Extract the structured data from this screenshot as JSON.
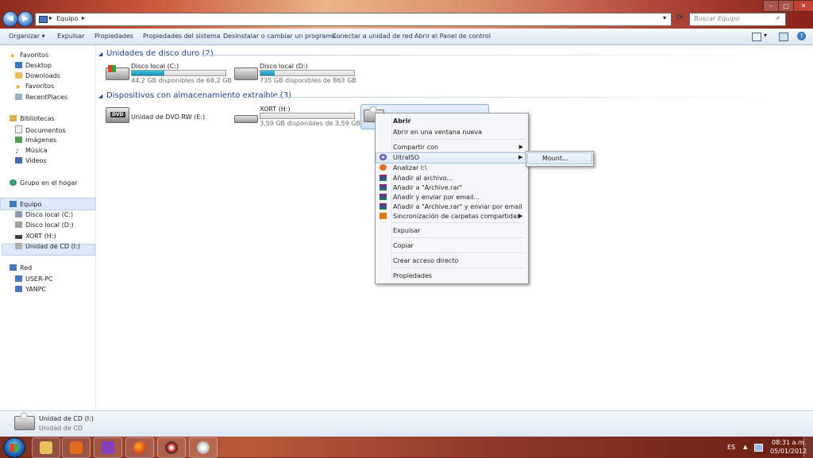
{
  "window": {
    "address_crumb": "Equipo",
    "search_placeholder": "Buscar Equipo"
  },
  "toolbar": {
    "items": [
      "Organizar",
      "Expulsar",
      "Propiedades",
      "Propiedades del sistema",
      "Desinstalar o cambiar un programa",
      "Conectar a unidad de red",
      "Abrir el Panel de control"
    ]
  },
  "nav": {
    "favoritos": "Favoritos",
    "fav_items": [
      "Desktop",
      "Downloads",
      "Favoritos",
      "RecentPlaces"
    ],
    "bibliotecas": "Bibliotecas",
    "lib_items": [
      "Documentos",
      "Imágenes",
      "Música",
      "Videos"
    ],
    "grupo": "Grupo en el hogar",
    "equipo": "Equipo",
    "equipo_items": [
      "Disco local (C:)",
      "Disco local (D:)",
      "XORT (H:)",
      "Unidad de CD (I:)"
    ],
    "red": "Red",
    "red_items": [
      "USER-PC",
      "YANPC"
    ]
  },
  "main": {
    "group_hdd": "Unidades de disco duro (2)",
    "group_removable": "Dispositivos con almacenamiento extraíble (3)",
    "drives": {
      "c": {
        "name": "Disco local (C:)",
        "free": "44,2 GB disponibles de 68,2 GB",
        "used_fraction": 0.35
      },
      "d": {
        "name": "Disco local (D:)",
        "free": "735 GB disponibles de 863 GB",
        "used_fraction": 0.15
      },
      "e": {
        "name": "Unidad de DVD RW (E:)"
      },
      "h": {
        "name": "XORT (H:)",
        "free": "3,59 GB disponibles de 3,59 GB",
        "used_fraction": 0.0
      }
    }
  },
  "context_menu": {
    "items": [
      "Abrir",
      "Abrir en una ventana nueva",
      "Compartir con",
      "UltraISO",
      "Analizar I:\\",
      "Añadir al archivo...",
      "Añadir a \"Archive.rar\"",
      "Añadir y enviar por email...",
      "Añadir a \"Archive.rar\" y enviar por email",
      "Sincronización de carpetas compartidas",
      "Expulsar",
      "Copiar",
      "Crear acceso directo",
      "Propiedades"
    ],
    "submenu_item": "Mount..."
  },
  "details": {
    "name": "Unidad de CD (I:)",
    "type": "Unidad de CD"
  },
  "taskbar": {
    "lang": "ES",
    "time": "08:31 a.m.",
    "date": "05/01/2012"
  },
  "colors": {
    "accent": "#1e3f8c",
    "bar_fill": "#26a9c8"
  }
}
